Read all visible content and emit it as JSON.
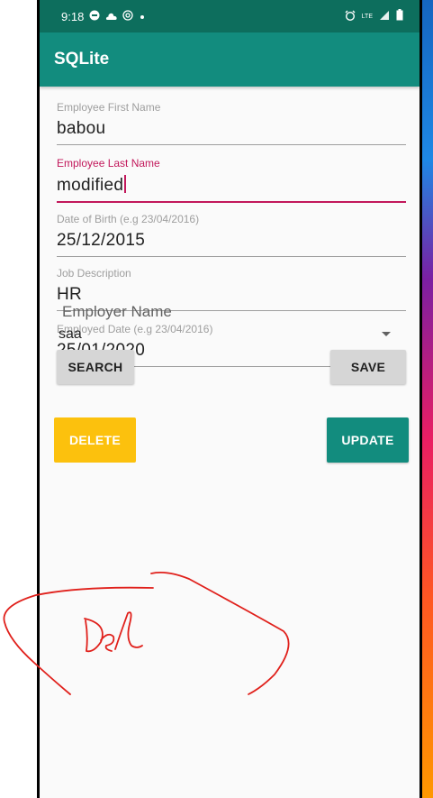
{
  "status_bar": {
    "time": "9:18",
    "left_icons": [
      "message-icon",
      "cloud-icon",
      "at-icon",
      "dot-icon"
    ],
    "right_icons": [
      "alarm-icon",
      "lte-icon",
      "signal-icon",
      "battery-icon"
    ],
    "lte_text": "LTE"
  },
  "app_bar": {
    "title": "SQLite"
  },
  "form": {
    "first_name": {
      "label": "Employee First Name",
      "value": "babou"
    },
    "last_name": {
      "label": "Employee Last Name",
      "value": "modified"
    },
    "dob": {
      "label": "Date of Birth (e.g 23/04/2016)",
      "value": "25/12/2015"
    },
    "job": {
      "label": "Job Description",
      "value": "HR"
    },
    "employed": {
      "label": "Employed Date (e.g 23/04/2016)",
      "value": "25/01/2020"
    }
  },
  "employer": {
    "label": "Employer Name",
    "selected": "saa"
  },
  "buttons": {
    "search": "SEARCH",
    "save": "SAVE",
    "delete": "DELETE",
    "update": "UPDATE"
  },
  "annotation": {
    "handwritten_text": "Del"
  },
  "colors": {
    "app_bar": "#128c7e",
    "status_bar": "#0d6e5d",
    "focus_accent": "#c2185b",
    "delete_button": "#fcc10d",
    "update_button": "#128c7e",
    "annotation_ink": "#e0201b"
  }
}
